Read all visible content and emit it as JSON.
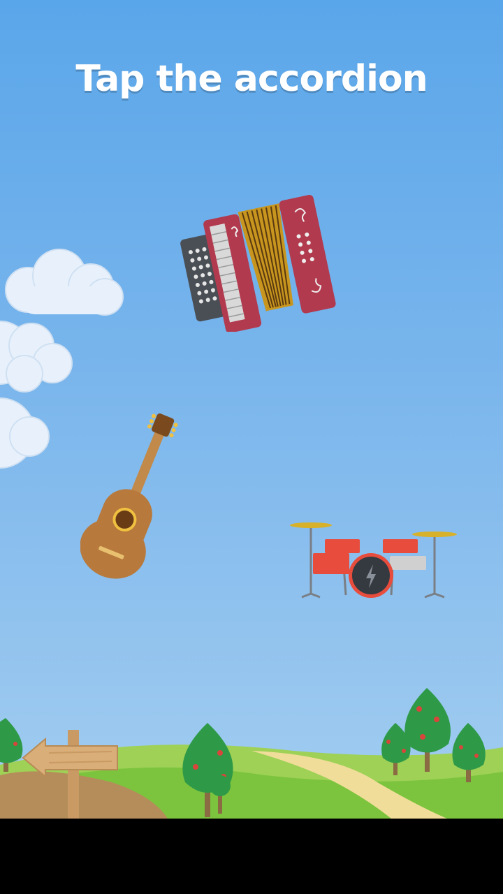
{
  "prompt": {
    "text": "Tap the accordion",
    "target": "accordion"
  },
  "instruments": [
    {
      "name": "accordion"
    },
    {
      "name": "guitar"
    },
    {
      "name": "drum-kit"
    }
  ],
  "colors": {
    "sky_top": "#5aa6ea",
    "sky_bottom": "#a3cdf0",
    "grass": "#7cc43e",
    "path": "#f1dd9a",
    "accordion_body": "#b23a4e",
    "guitar_body": "#b8793c",
    "drum_red": "#e74c3c"
  },
  "navigation": {
    "back_icon": "wooden-arrow-sign-left-icon"
  }
}
